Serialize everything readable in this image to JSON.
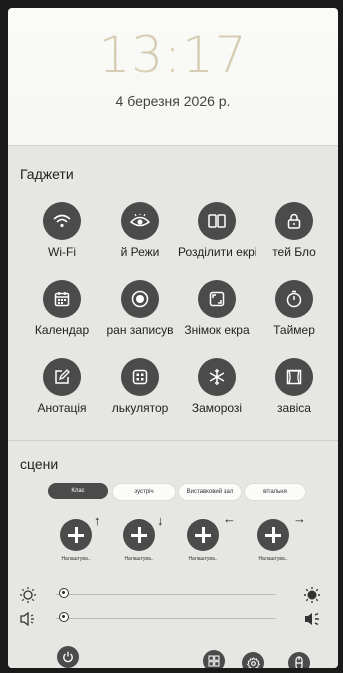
{
  "lockscreen": {
    "time": "13:17",
    "date": "4 березня 2026 р."
  },
  "gadgets": {
    "title": "Гаджети",
    "items": [
      {
        "label": "Wi-Fi",
        "icon": "wifi-icon"
      },
      {
        "label": "й   Режи",
        "icon": "eye-icon"
      },
      {
        "label": "Розділити екрі",
        "icon": "split-screen-icon"
      },
      {
        "label": "тей   Бло",
        "icon": "lock-icon"
      },
      {
        "label": "Календар",
        "icon": "calendar-icon"
      },
      {
        "label": "ран записув",
        "icon": "screen-record-icon"
      },
      {
        "label": "Знімок екра",
        "icon": "screenshot-icon"
      },
      {
        "label": "Таймер",
        "icon": "timer-icon"
      },
      {
        "label": "Анотація",
        "icon": "annotation-icon"
      },
      {
        "label": "лькулятор",
        "icon": "calculator-icon"
      },
      {
        "label": "Заморозі",
        "icon": "snowflake-icon"
      },
      {
        "label": "завіса",
        "icon": "curtain-icon"
      }
    ]
  },
  "scenes": {
    "title": "сцени",
    "chips": [
      {
        "label": "Клас",
        "active": true
      },
      {
        "label": "зустріч",
        "active": false
      },
      {
        "label": "Виставковий зал",
        "active": false
      },
      {
        "label": "вітальня",
        "active": false
      }
    ],
    "presets": [
      {
        "label": "Налаштува..",
        "arrow": "↑"
      },
      {
        "label": "Налаштува..",
        "arrow": "↓"
      },
      {
        "label": "Налаштува..",
        "arrow": "←"
      },
      {
        "label": "Налаштува..",
        "arrow": "→"
      }
    ]
  },
  "sliders": {
    "brightness": {
      "value": 0.0,
      "left_icon": "brightness-low-icon",
      "right_icon": "brightness-high-icon"
    },
    "volume": {
      "value": 0.0,
      "left_icon": "volume-low-icon",
      "right_icon": "volume-high-icon"
    }
  },
  "bottom_bar": {
    "buttons": [
      "power-icon",
      "windows-icon",
      "settings-icon",
      "touch-icon"
    ]
  }
}
